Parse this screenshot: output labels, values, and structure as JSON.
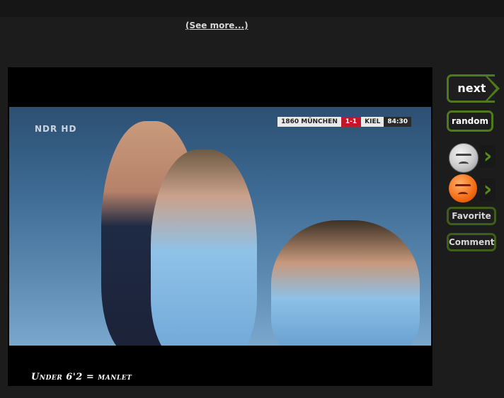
{
  "header": {
    "see_more": "(See more...)"
  },
  "media": {
    "channel_logo": "NDR HD",
    "scoreboard": {
      "home": "1860 MÜNCHEN",
      "score": "1-1",
      "away": "KIEL",
      "time": "84:30"
    },
    "caption": "Under 6'2 = manlet"
  },
  "sidebar": {
    "next_label": "next",
    "random_label": "random",
    "vote_up_icon": "grinning-face-icon",
    "vote_down_icon": "angry-face-icon",
    "favorite_label": "Favorite",
    "comment_label": "Comment"
  },
  "colors": {
    "accent": "#4f7a1c",
    "background": "#1c1c1c",
    "score_red": "#c4162a"
  }
}
